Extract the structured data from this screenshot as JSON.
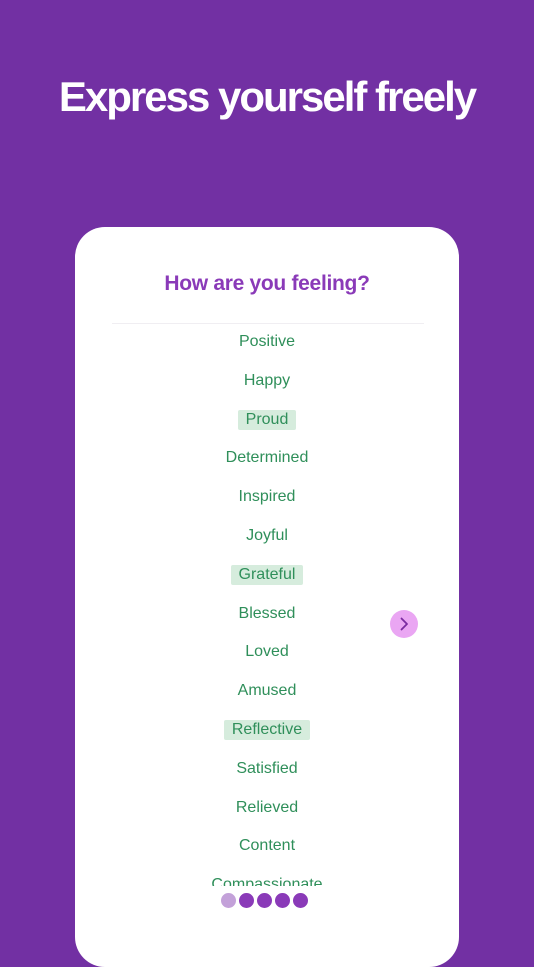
{
  "headline": "Express yourself freely",
  "card": {
    "title": "How are you feeling?",
    "feelings": [
      {
        "label": "Positive",
        "selected": false
      },
      {
        "label": "Happy",
        "selected": false
      },
      {
        "label": "Proud",
        "selected": true
      },
      {
        "label": "Determined",
        "selected": false
      },
      {
        "label": "Inspired",
        "selected": false
      },
      {
        "label": "Joyful",
        "selected": false
      },
      {
        "label": "Grateful",
        "selected": true
      },
      {
        "label": "Blessed",
        "selected": false
      },
      {
        "label": "Loved",
        "selected": false
      },
      {
        "label": "Amused",
        "selected": false
      },
      {
        "label": "Reflective",
        "selected": true
      },
      {
        "label": "Satisfied",
        "selected": false
      },
      {
        "label": "Relieved",
        "selected": false
      },
      {
        "label": "Content",
        "selected": false
      },
      {
        "label": "Compassionate",
        "selected": false
      }
    ],
    "next_icon": "chevron-right-icon"
  },
  "pagination": {
    "pages": 5,
    "current": 1
  },
  "colors": {
    "background": "#7230a3",
    "title": "#8a3ab8",
    "feeling_text": "#2f8f5a",
    "feeling_selected_bg": "#d6ecdd",
    "next_button_bg": "#eaa6f3",
    "dot_active": "#c3a1d9",
    "dot_inactive": "#8a3ab8"
  }
}
